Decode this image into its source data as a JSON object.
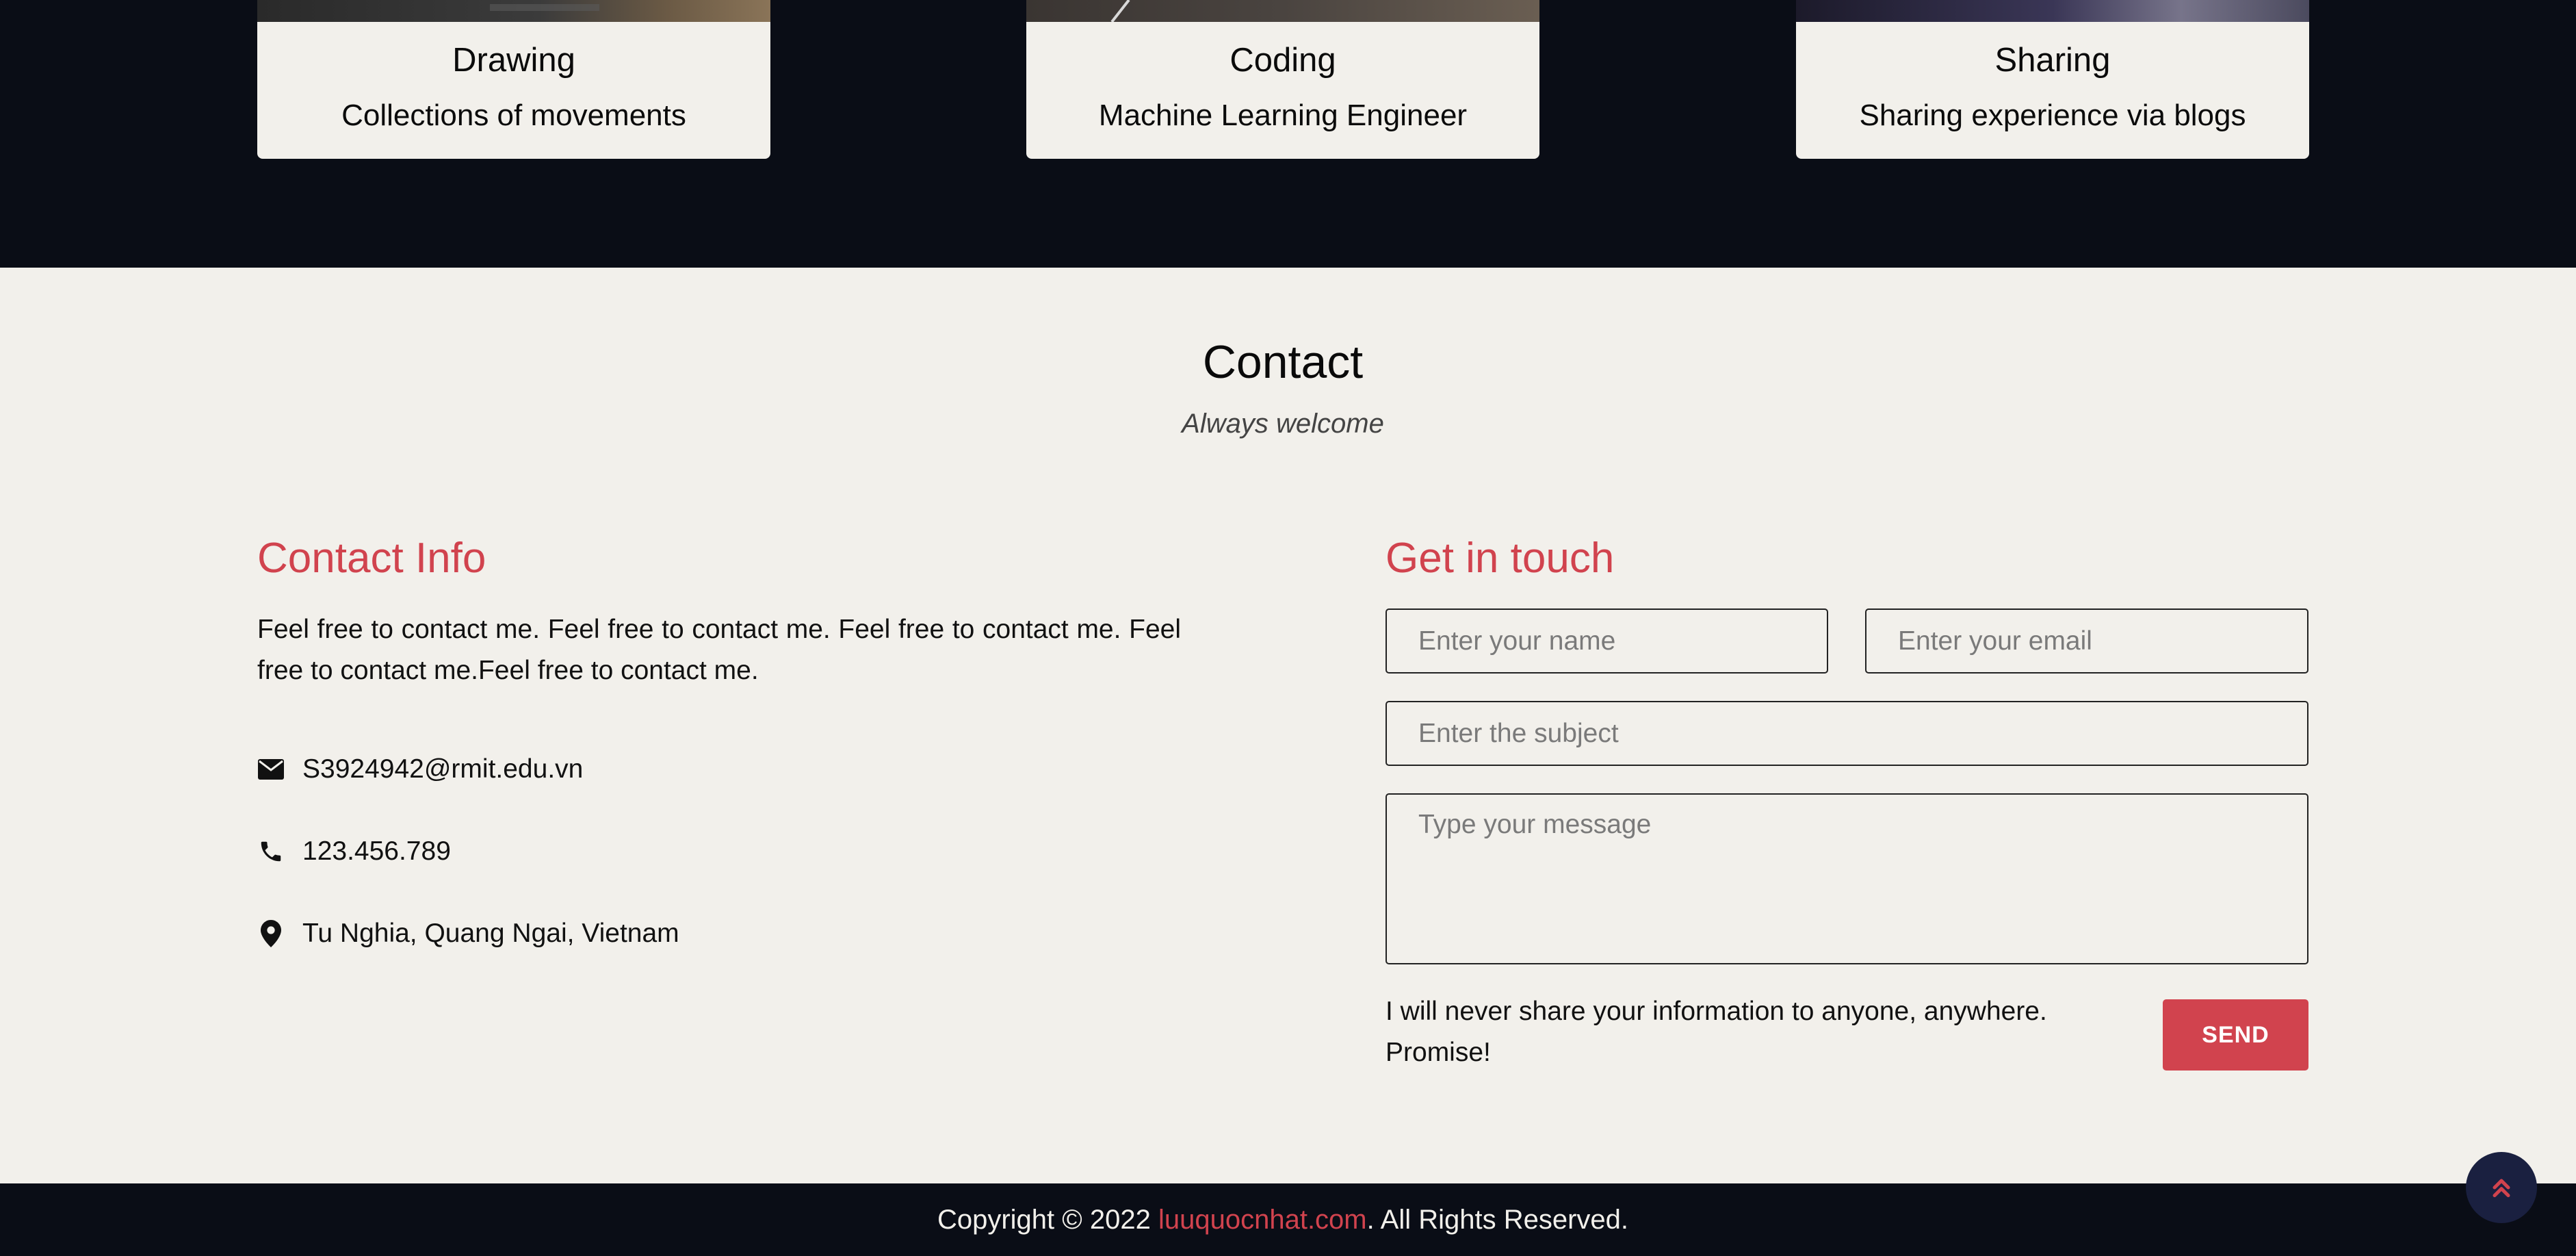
{
  "colors": {
    "accent": "#d1434e",
    "dark": "#0a0d16",
    "light": "#f2f0eb",
    "back_to_top": "#1a2040"
  },
  "cards": [
    {
      "title": "Drawing",
      "subtitle": "Collections of movements"
    },
    {
      "title": "Coding",
      "subtitle": "Machine Learning Engineer"
    },
    {
      "title": "Sharing",
      "subtitle": "Sharing experience via blogs"
    }
  ],
  "contact": {
    "title": "Contact",
    "subtitle": "Always welcome"
  },
  "contact_info": {
    "heading": "Contact Info",
    "description": "Feel free to contact me. Feel free to contact me. Feel free to contact me. Feel free to contact me.Feel free to contact me.",
    "items": [
      {
        "icon": "envelope-icon",
        "text": "S3924942@rmit.edu.vn"
      },
      {
        "icon": "phone-icon",
        "text": "123.456.789"
      },
      {
        "icon": "map-marker-icon",
        "text": "Tu Nghia, Quang Ngai, Vietnam"
      }
    ]
  },
  "form": {
    "heading": "Get in touch",
    "name_placeholder": "Enter your name",
    "email_placeholder": "Enter your email",
    "subject_placeholder": "Enter the subject",
    "message_placeholder": "Type your message",
    "promise": "I will never share your information to anyone, anywhere. Promise!",
    "send_label": "SEND"
  },
  "footer": {
    "prefix": "Copyright © 2022 ",
    "link": "luuquocnhat.com",
    "suffix": ". All Rights Reserved."
  },
  "back_to_top_icon": "double-chevron-up-icon"
}
